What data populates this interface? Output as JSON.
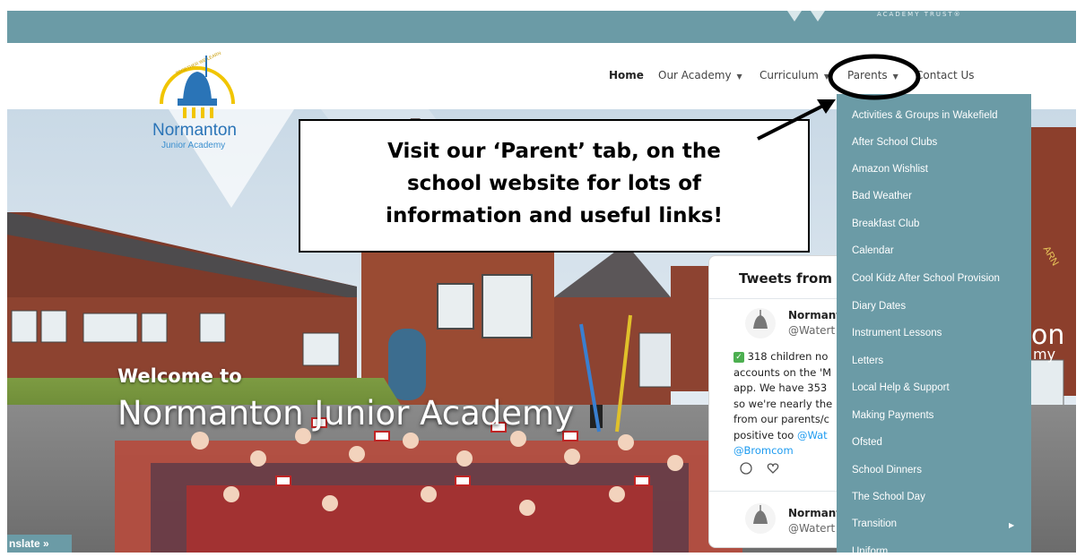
{
  "topbar": {
    "trust_text": "ACADEMY TRUST®"
  },
  "logo": {
    "arc_text": "TOGETHER WE LEARN",
    "name": "Normanton",
    "subtitle": "Junior Academy"
  },
  "nav": {
    "items": [
      {
        "label": "Home",
        "caret": false
      },
      {
        "label": "Our Academy",
        "caret": true
      },
      {
        "label": "Curriculum",
        "caret": true
      },
      {
        "label": "Parents",
        "caret": true
      },
      {
        "label": "Contact Us",
        "caret": false
      }
    ]
  },
  "hero": {
    "welcome_small": "Welcome to",
    "welcome_big": "Normanton Junior Academy"
  },
  "callout": {
    "line1": "Visit our ‘Parent’ tab, on the",
    "line2": "school website for lots of",
    "line3": "information and useful links!"
  },
  "twitter": {
    "title": "Tweets from @",
    "tweet1": {
      "name": "Normant",
      "handle": "@Watert",
      "body": [
        "318 children no",
        "accounts on the 'M",
        "app. We have 353",
        "so we're nearly the",
        "from our parents/c",
        "positive too",
        "@Bromcom"
      ],
      "mention": "@Wat"
    },
    "tweet2": {
      "name": "Normant",
      "handle": "@Watert"
    }
  },
  "parents_menu": {
    "items": [
      "Activities & Groups in Wakefield",
      "After School Clubs",
      "Amazon Wishlist",
      "Bad Weather",
      "Breakfast Club",
      "Calendar",
      "Cool Kidz After School Provision",
      "Diary Dates",
      "Instrument Lessons",
      "Letters",
      "Local Help & Support",
      "Making Payments",
      "Ofsted",
      "School Dinners",
      "The School Day",
      "Transition",
      "Uniform"
    ],
    "submenu_arrow_item": "Transition"
  },
  "right_edge": {
    "big": "on",
    "small": "my",
    "arc": "ARN"
  },
  "translate": {
    "label": "nslate »"
  },
  "colors": {
    "accent": "#6b9ba6",
    "logo_blue": "#2a74b7",
    "twitter_blue": "#1d9bf0"
  }
}
